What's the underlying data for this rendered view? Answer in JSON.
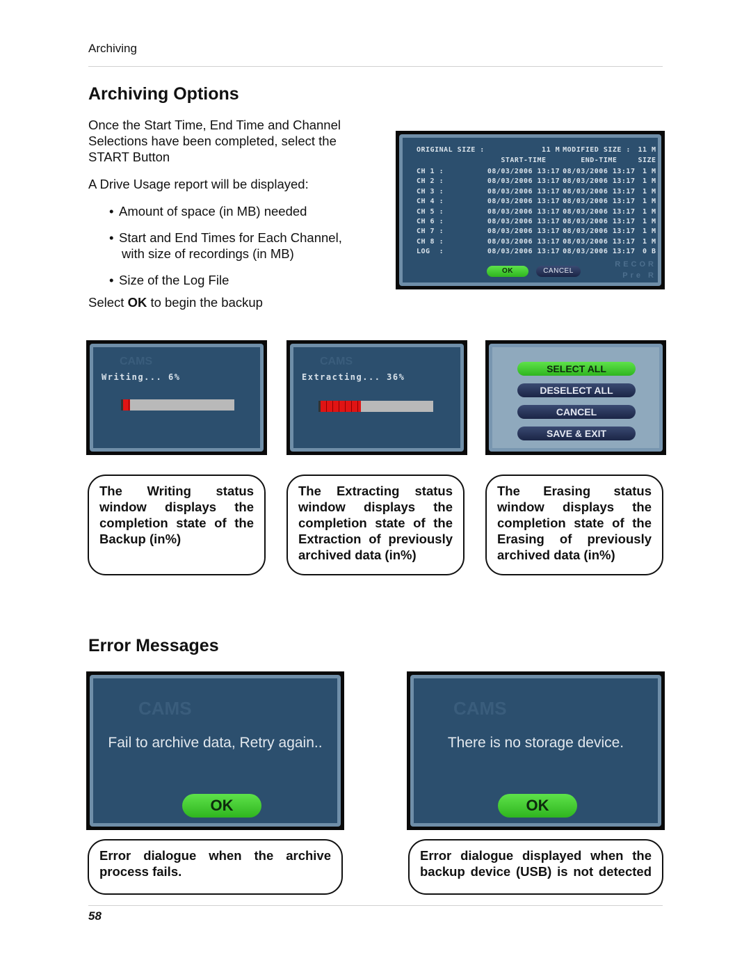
{
  "header": {
    "running_head": "Archiving"
  },
  "section1": {
    "title": "Archiving Options",
    "intro_lines": [
      "Once the Start Time, End Time and Channel",
      "Selections have been completed, select the",
      "START Button"
    ],
    "report_intro": "A Drive Usage report will be displayed:",
    "bullets": [
      {
        "symbol": "•",
        "lines": [
          "Amount of space (in MB) needed"
        ]
      },
      {
        "symbol": "•",
        "lines": [
          "Start and End Times for Each Channel,",
          "with size of recordings (in MB)"
        ]
      },
      {
        "symbol": "•",
        "lines": [
          "Size of the Log File"
        ]
      }
    ],
    "select_prefix": "Select ",
    "select_bold": "OK",
    "select_suffix": " to begin the backup"
  },
  "drive_usage_report": {
    "original_size_label": "ORIGINAL SIZE :",
    "original_size_value": "11 M",
    "modified_size_label": "MODIFIED SIZE :",
    "modified_size_value": "11 M",
    "columns": [
      "START-TIME",
      "END-TIME",
      "SIZE"
    ],
    "rows": [
      {
        "channel": "CH 1",
        "start": "08/03/2006 13:17",
        "end": "08/03/2006 13:17",
        "size": "1 M"
      },
      {
        "channel": "CH 2",
        "start": "08/03/2006 13:17",
        "end": "08/03/2006 13:17",
        "size": "1 M"
      },
      {
        "channel": "CH 3",
        "start": "08/03/2006 13:17",
        "end": "08/03/2006 13:17",
        "size": "1 M"
      },
      {
        "channel": "CH 4",
        "start": "08/03/2006 13:17",
        "end": "08/03/2006 13:17",
        "size": "1 M"
      },
      {
        "channel": "CH 5",
        "start": "08/03/2006 13:17",
        "end": "08/03/2006 13:17",
        "size": "1 M"
      },
      {
        "channel": "CH 6",
        "start": "08/03/2006 13:17",
        "end": "08/03/2006 13:17",
        "size": "1 M"
      },
      {
        "channel": "CH 7",
        "start": "08/03/2006 13:17",
        "end": "08/03/2006 13:17",
        "size": "1 M"
      },
      {
        "channel": "CH 8",
        "start": "08/03/2006 13:17",
        "end": "08/03/2006 13:17",
        "size": "1 M"
      },
      {
        "channel": "LOG",
        "start": "08/03/2006 13:17",
        "end": "08/03/2006 13:17",
        "size": "0 B"
      }
    ],
    "ok_label": "OK",
    "cancel_label": "CANCEL",
    "bg_watermark_1": "RECOR",
    "bg_watermark_2": "Pre R"
  },
  "status_screens": {
    "writing": {
      "label": "Writing... 6%",
      "percent": 6,
      "watermark": "CAMS"
    },
    "extracting": {
      "label": "Extracting... 36%",
      "percent": 36,
      "watermark": "CAMS"
    },
    "erase_menu": {
      "buttons": [
        "SELECT ALL",
        "DESELECT ALL",
        "CANCEL",
        "SAVE & EXIT"
      ]
    }
  },
  "captions": {
    "writing": [
      "The Writing status",
      "window displays the",
      "completion state of the",
      "Backup (in%)"
    ],
    "extracting": [
      "The Extracting status",
      "window displays the",
      "completion state of the",
      "Extraction of previously",
      "archived data (in%)"
    ],
    "erasing": [
      "The Erasing status",
      "window displays the",
      "completion state of the",
      "Erasing of previously",
      "archived data (in%)"
    ]
  },
  "section2": {
    "title": "Error Messages",
    "errors": [
      {
        "message": "Fail to archive data, Retry again..",
        "ok_label": "OK",
        "watermark": "CAMS",
        "caption": [
          "Error dialogue when the archive",
          "process fails."
        ]
      },
      {
        "message": "There is no storage device.",
        "ok_label": "OK",
        "watermark": "CAMS",
        "caption": [
          "Error dialogue displayed when the",
          "backup device (USB) is not detected"
        ]
      }
    ]
  },
  "footer": {
    "page_number": "58"
  },
  "colors": {
    "screen_blue": "#2c4f6e",
    "button_green": "#3fcc2f",
    "progress_red": "#e01414"
  }
}
